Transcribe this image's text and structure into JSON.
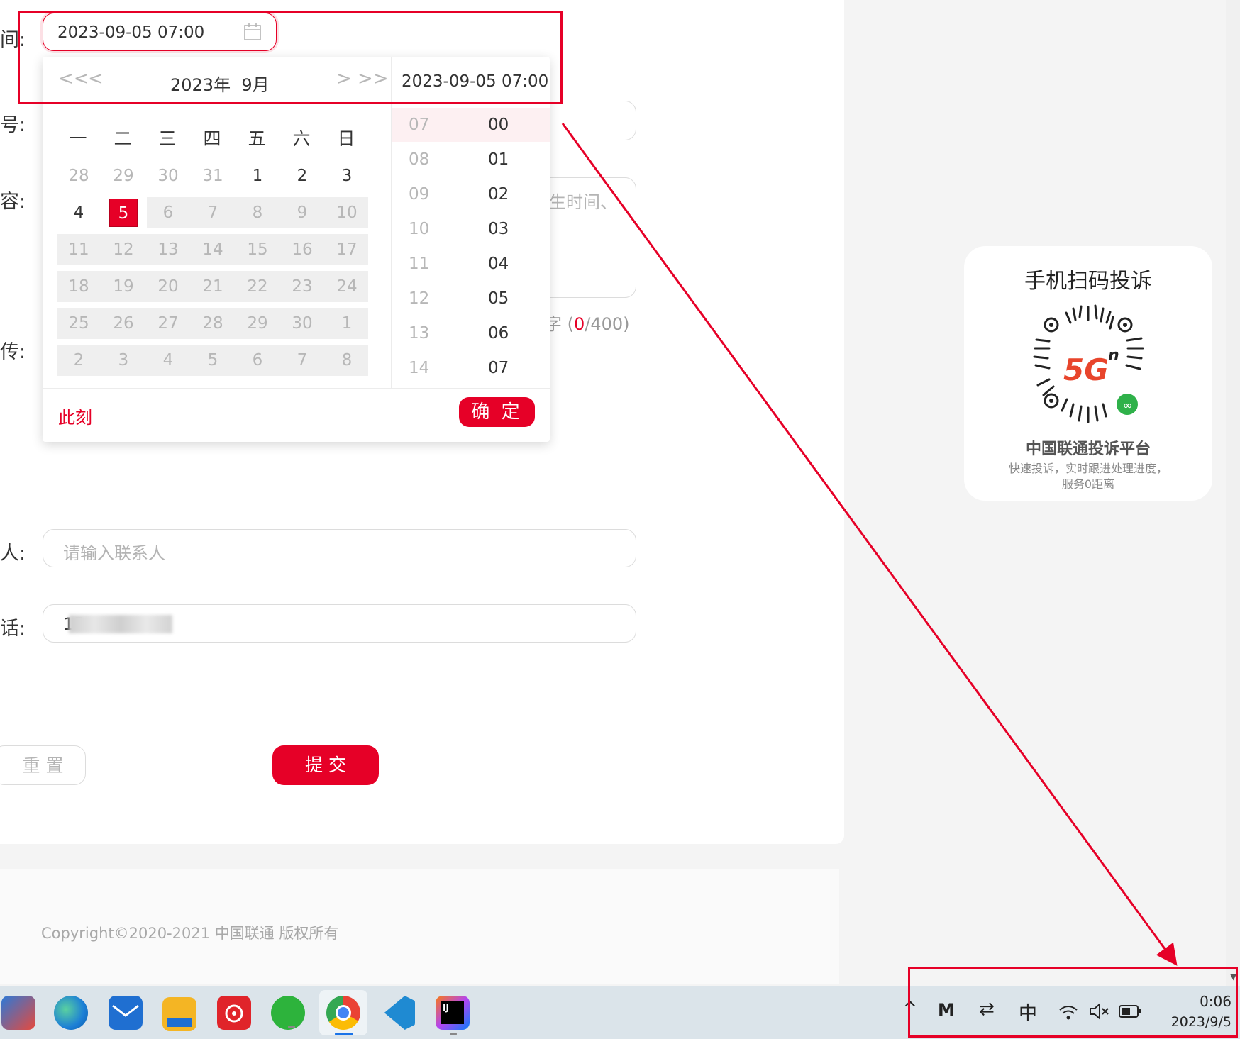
{
  "form": {
    "time_label": "间:",
    "number_label": "号:",
    "content_label": "容:",
    "upload_label": "传:",
    "contact_label": "人:",
    "phone_label": "话:",
    "date_value": "2023-09-05 07:00",
    "content_placeholder_fragment": "生时间、",
    "char_count_prefix": "字 (",
    "char_count_current": "0",
    "char_count_max": "/400)",
    "contact_placeholder": "请输入联系人",
    "phone_value_visible": "15",
    "reset_label": "重 置",
    "submit_label": "提 交"
  },
  "picker": {
    "nav_prev_year": "<<",
    "nav_prev_month": "<",
    "nav_next_month": ">",
    "nav_next_year": ">>",
    "month_title": "2023年  9月",
    "selected_datetime": "2023-09-05 07:00",
    "weekdays": [
      "一",
      "二",
      "三",
      "四",
      "五",
      "六",
      "日"
    ],
    "weeks": [
      [
        "28",
        "29",
        "30",
        "31",
        "1",
        "2",
        "3"
      ],
      [
        "4",
        "5",
        "6",
        "7",
        "8",
        "9",
        "10"
      ],
      [
        "11",
        "12",
        "13",
        "14",
        "15",
        "16",
        "17"
      ],
      [
        "18",
        "19",
        "20",
        "21",
        "22",
        "23",
        "24"
      ],
      [
        "25",
        "26",
        "27",
        "28",
        "29",
        "30",
        "1"
      ],
      [
        "2",
        "3",
        "4",
        "5",
        "6",
        "7",
        "8"
      ]
    ],
    "selected_day": "5",
    "hours": [
      "07",
      "08",
      "09",
      "10",
      "11",
      "12",
      "13",
      "14"
    ],
    "minutes": [
      "00",
      "01",
      "02",
      "03",
      "04",
      "05",
      "06",
      "07"
    ],
    "now_label": "此刻",
    "confirm_label": "确 定"
  },
  "qr_panel": {
    "title": "手机扫码投诉",
    "logo_text": "5G",
    "logo_sup": "n",
    "platform": "中国联通投诉平台",
    "desc_line1": "快速投诉，实时跟进处理进度，",
    "desc_line2": "服务0距离"
  },
  "footer": {
    "copyright": "Copyright©2020-2021 中国联通 版权所有"
  },
  "taskbar": {
    "apps": [
      "windows-start",
      "edge",
      "mail",
      "file-explorer",
      "netease-music",
      "wechat",
      "chrome",
      "vscode",
      "intellij"
    ],
    "ime": "中",
    "time": "0:06",
    "date": "2023/9/5"
  },
  "colors": {
    "accent": "#e60027",
    "annotation": "#e60027"
  }
}
